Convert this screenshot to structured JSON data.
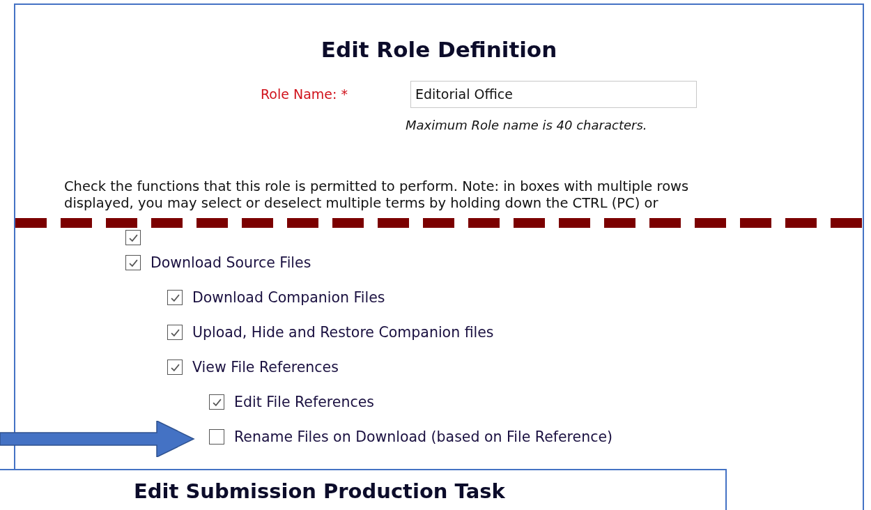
{
  "title": "Edit Role Definition",
  "role_name": {
    "label": "Role Name: *",
    "value": "Editorial Office",
    "hint": "Maximum Role name is 40 characters."
  },
  "instructions": [
    "Check the functions that this role is permitted to perform. Note: in boxes with multiple rows",
    "displayed, you may select or deselect multiple terms by holding down the CTRL (PC) or"
  ],
  "permissions": [
    {
      "checked": true
    },
    {
      "label": "Download Source Files",
      "checked": true,
      "children": [
        {
          "label": "Download Companion Files",
          "checked": true
        },
        {
          "label": "Upload, Hide and Restore Companion files",
          "checked": true
        },
        {
          "label": "View File References",
          "checked": true,
          "children": [
            {
              "label": "Edit File References",
              "checked": true
            },
            {
              "label": "Rename Files on Download (based on File Reference)",
              "checked": false
            }
          ]
        }
      ]
    }
  ],
  "overlay_panel": {
    "title": "Edit Submission Production Task"
  }
}
